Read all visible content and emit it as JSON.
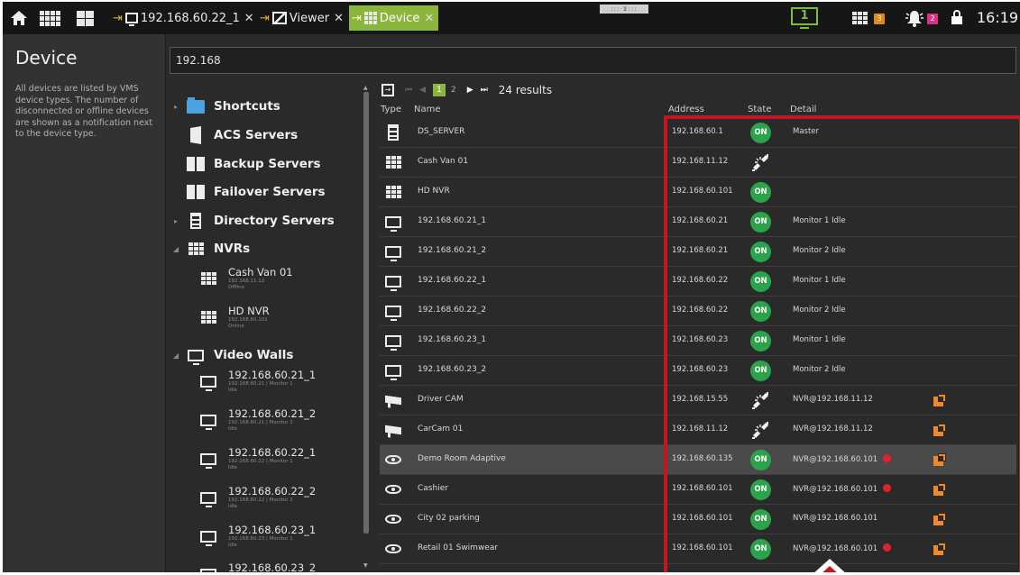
{
  "tabs": [
    {
      "label": "192.168.60.22_1",
      "icon": "monitor-icon",
      "active": false
    },
    {
      "label": "Viewer",
      "icon": "viewer-icon",
      "active": false
    },
    {
      "label": "Device",
      "icon": "device-icon",
      "active": true
    }
  ],
  "topbar": {
    "monitor_number": "1",
    "notification_badge_1": "3",
    "notification_badge_2": "2",
    "time": "16:19"
  },
  "left_panel": {
    "title": "Device",
    "description": "All devices are listed by VMS device types. The number of disconnected or offline devices are shown as a notification next to the device type."
  },
  "search": {
    "value": "192.168"
  },
  "tree": {
    "categories": [
      {
        "label": "Shortcuts",
        "icon": "folder-icon"
      },
      {
        "label": "ACS Servers",
        "icon": "door-icon"
      },
      {
        "label": "Backup Servers",
        "icon": "backup-server-icon"
      },
      {
        "label": "Failover Servers",
        "icon": "failover-server-icon"
      },
      {
        "label": "Directory Servers",
        "icon": "directory-server-icon"
      },
      {
        "label": "NVRs",
        "icon": "nvr-icon"
      },
      {
        "label": "Video Walls",
        "icon": "monitor-icon"
      }
    ],
    "nvrs": [
      {
        "name": "Cash Van 01",
        "meta1": "192.168.11.12",
        "meta2": "Offline"
      },
      {
        "name": "HD NVR",
        "meta1": "192.168.60.101",
        "meta2": "Online"
      }
    ],
    "walls": [
      {
        "name": "192.168.60.21_1",
        "meta1": "192.168.60.21",
        "meta2": "Monitor 1",
        "meta3": "Idle"
      },
      {
        "name": "192.168.60.21_2",
        "meta1": "192.168.60.21",
        "meta2": "Monitor 2",
        "meta3": "Idle"
      },
      {
        "name": "192.168.60.22_1",
        "meta1": "192.168.60.22",
        "meta2": "Monitor 1",
        "meta3": "Idle"
      },
      {
        "name": "192.168.60.22_2",
        "meta1": "192.168.60.22",
        "meta2": "Monitor 2",
        "meta3": "Idle"
      },
      {
        "name": "192.168.60.23_1",
        "meta1": "192.168.60.23",
        "meta2": "Monitor 1",
        "meta3": "Idle"
      },
      {
        "name": "192.168.60.23_2",
        "meta1": "",
        "meta2": "",
        "meta3": ""
      }
    ]
  },
  "pager": {
    "current": "1",
    "next": "2",
    "results": "24 results"
  },
  "columns": {
    "type": "Type",
    "name": "Name",
    "address": "Address",
    "state": "State",
    "detail": "Detail"
  },
  "rows": [
    {
      "type": "server",
      "name": "DS_SERVER",
      "address": "192.168.60.1",
      "state": "ON",
      "detail": "Master",
      "alert": false,
      "link": false
    },
    {
      "type": "nvr",
      "name": "Cash Van 01",
      "address": "192.168.11.12",
      "state": "disconnected",
      "detail": "",
      "alert": false,
      "link": false
    },
    {
      "type": "nvr",
      "name": "HD NVR",
      "address": "192.168.60.101",
      "state": "ON",
      "detail": "",
      "alert": false,
      "link": false
    },
    {
      "type": "monitor",
      "name": "192.168.60.21_1",
      "address": "192.168.60.21",
      "state": "ON",
      "detail": "Monitor 1  Idle",
      "alert": false,
      "link": false
    },
    {
      "type": "monitor",
      "name": "192.168.60.21_2",
      "address": "192.168.60.21",
      "state": "ON",
      "detail": "Monitor 2  Idle",
      "alert": false,
      "link": false
    },
    {
      "type": "monitor",
      "name": "192.168.60.22_1",
      "address": "192.168.60.22",
      "state": "ON",
      "detail": "Monitor 1  Idle",
      "alert": false,
      "link": false
    },
    {
      "type": "monitor",
      "name": "192.168.60.22_2",
      "address": "192.168.60.22",
      "state": "ON",
      "detail": "Monitor 2  Idle",
      "alert": false,
      "link": false
    },
    {
      "type": "monitor",
      "name": "192.168.60.23_1",
      "address": "192.168.60.23",
      "state": "ON",
      "detail": "Monitor 1  Idle",
      "alert": false,
      "link": false
    },
    {
      "type": "monitor",
      "name": "192.168.60.23_2",
      "address": "192.168.60.23",
      "state": "ON",
      "detail": "Monitor 2  Idle",
      "alert": false,
      "link": false
    },
    {
      "type": "camera",
      "name": "Driver CAM",
      "address": "192.168.15.55",
      "state": "disconnected",
      "detail": "NVR@192.168.11.12",
      "alert": false,
      "link": true
    },
    {
      "type": "camera",
      "name": "CarCam 01",
      "address": "192.168.11.12",
      "state": "disconnected",
      "detail": "NVR@192.168.11.12",
      "alert": false,
      "link": true
    },
    {
      "type": "dome",
      "name": "Demo Room Adaptive",
      "address": "192.168.60.135",
      "state": "ON",
      "detail": "NVR@192.168.60.101",
      "alert": true,
      "link": true,
      "selected": true
    },
    {
      "type": "dome",
      "name": "Cashier",
      "address": "192.168.60.101",
      "state": "ON",
      "detail": "NVR@192.168.60.101",
      "alert": true,
      "link": true
    },
    {
      "type": "dome",
      "name": "City 02 parking",
      "address": "192.168.60.101",
      "state": "ON",
      "detail": "NVR@192.168.60.101",
      "alert": false,
      "link": true
    },
    {
      "type": "dome",
      "name": "Retail 01 Swimwear",
      "address": "192.168.60.101",
      "state": "ON",
      "detail": "NVR@192.168.60.101",
      "alert": true,
      "link": true
    }
  ],
  "colors": {
    "accent": "#8ab63c",
    "on": "#2aa34a",
    "alert": "#e0232a",
    "link": "#f0892a",
    "annotation": "#c3161f"
  }
}
